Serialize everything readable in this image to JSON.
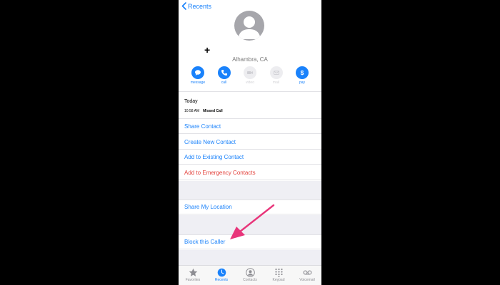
{
  "nav": {
    "back_label": "Recents"
  },
  "contact": {
    "location": "Alhambra, CA",
    "add_symbol": "+"
  },
  "actions": [
    {
      "label": "message",
      "enabled": true,
      "icon": "message-icon"
    },
    {
      "label": "call",
      "enabled": true,
      "icon": "phone-icon"
    },
    {
      "label": "video",
      "enabled": false,
      "icon": "video-icon"
    },
    {
      "label": "mail",
      "enabled": false,
      "icon": "mail-icon"
    },
    {
      "label": "pay",
      "enabled": true,
      "icon": "dollar-icon"
    }
  ],
  "history": {
    "day": "Today",
    "time": "10:58 AM",
    "type": "Missed Call"
  },
  "menu": {
    "share_contact": "Share Contact",
    "create_contact": "Create New Contact",
    "add_existing": "Add to Existing Contact",
    "add_emergency": "Add to Emergency Contacts",
    "share_location": "Share My Location",
    "block_caller": "Block this Caller"
  },
  "tabs": [
    {
      "label": "Favorites",
      "icon": "star-icon",
      "active": false
    },
    {
      "label": "Recents",
      "icon": "clock-icon",
      "active": true
    },
    {
      "label": "Contacts",
      "icon": "person-circle-icon",
      "active": false
    },
    {
      "label": "Keypad",
      "icon": "keypad-icon",
      "active": false
    },
    {
      "label": "Voicemail",
      "icon": "voicemail-icon",
      "active": false
    }
  ],
  "colors": {
    "accent": "#1a82fb",
    "destructive": "#e3413b",
    "annotation_arrow": "#e8357a"
  }
}
